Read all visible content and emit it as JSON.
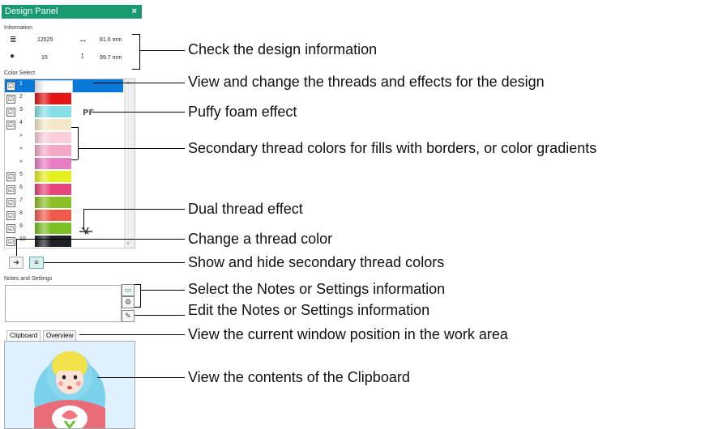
{
  "panel": {
    "title": "Design Panel",
    "close_glyph": "×",
    "info_label": "Information",
    "stitches": "12525",
    "width": "61.6 mm",
    "colors": "15",
    "height": "99.7 mm",
    "color_select_label": "Color Select",
    "notes_label": "Notes and Settings",
    "tabs": [
      "Clipboard",
      "Overview"
    ],
    "pf_badge": "PF",
    "threads": [
      {
        "num": "1",
        "check": "☑",
        "color": "#ffffff",
        "selected": true
      },
      {
        "num": "2",
        "check": "☑",
        "color": "#e31515"
      },
      {
        "num": "3",
        "check": "☑",
        "color": "#86dfe6"
      },
      {
        "num": "4",
        "check": "☑",
        "color": "#f5e8c8"
      },
      {
        "num": "»",
        "check": "",
        "color": "#f9cfd9"
      },
      {
        "num": "»",
        "check": "",
        "color": "#f4a8c6"
      },
      {
        "num": "»",
        "check": "",
        "color": "#e87fc4"
      },
      {
        "num": "5",
        "check": "☑",
        "color": "#e5f01f"
      },
      {
        "num": "6",
        "check": "☑",
        "color": "#e8457a"
      },
      {
        "num": "7",
        "check": "☑",
        "color": "#8cbf26"
      },
      {
        "num": "8",
        "check": "☑",
        "color": "#ef5a4a"
      },
      {
        "num": "9",
        "check": "☑",
        "color": "#7bc025"
      },
      {
        "num": "10",
        "check": "☑",
        "color": "#1d2024"
      },
      {
        "num": "11",
        "check": "☑",
        "color": "#f5e100"
      }
    ]
  },
  "callouts": {
    "c1": "Check the design information",
    "c2": "View and change the threads and effects for the design",
    "c3": "Puffy foam effect",
    "c4": "Secondary thread colors for fills with borders, or color gradients",
    "c5": "Dual thread effect",
    "c6": "Change a thread color",
    "c7": "Show and hide secondary thread colors",
    "c8": "Select the Notes or Settings information",
    "c9": "Edit the Notes or Settings information",
    "c10": "View the current window position in the work area",
    "c11": "View the contents of the Clipboard"
  },
  "icons": {
    "stitches": "stitches-icon",
    "width": "width-arrow-icon",
    "colors": "palette-icon",
    "height": "height-arrow-icon",
    "change_color": "change-thread-color-icon",
    "secondary_toggle": "secondary-colors-toggle-icon",
    "notes": "notes-icon",
    "settings": "gear-icon",
    "edit": "pencil-icon",
    "dual": "dual-thread-icon"
  }
}
